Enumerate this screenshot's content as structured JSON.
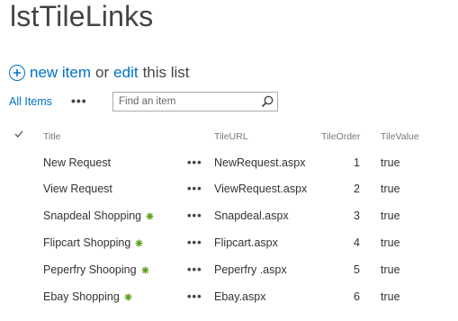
{
  "page": {
    "title": "lstTileLinks"
  },
  "command_bar": {
    "new_item": "new item",
    "or": "or",
    "edit": "edit",
    "this_list": "this list"
  },
  "views": {
    "all_items": "All Items",
    "more": "•••"
  },
  "search": {
    "placeholder": "Find an item"
  },
  "table": {
    "columns": {
      "title": "Title",
      "tileurl": "TileURL",
      "tileorder": "TileOrder",
      "tilevalue": "TileValue"
    },
    "rows": [
      {
        "title": "New Request",
        "is_new": false,
        "ellipsis": "•••",
        "tileurl": "NewRequest.aspx",
        "tileorder": "1",
        "tilevalue": "true"
      },
      {
        "title": "View Request",
        "is_new": false,
        "ellipsis": "•••",
        "tileurl": "ViewRequest.aspx",
        "tileorder": "2",
        "tilevalue": "true"
      },
      {
        "title": "Snapdeal Shopping",
        "is_new": true,
        "ellipsis": "•••",
        "tileurl": "Snapdeal.aspx",
        "tileorder": "3",
        "tilevalue": "true"
      },
      {
        "title": "Flipcart Shopping",
        "is_new": true,
        "ellipsis": "•••",
        "tileurl": "Flipcart.aspx",
        "tileorder": "4",
        "tilevalue": "true"
      },
      {
        "title": "Peperfry Shooping",
        "is_new": true,
        "ellipsis": "•••",
        "tileurl": "Peperfry .aspx",
        "tileorder": "5",
        "tilevalue": "true"
      },
      {
        "title": "Ebay Shopping",
        "is_new": true,
        "ellipsis": "•••",
        "tileurl": "Ebay.aspx",
        "tileorder": "6",
        "tilevalue": "true"
      }
    ]
  },
  "colors": {
    "link": "#0072c6",
    "new_indicator": "#5e9f1d",
    "header_text": "#777777"
  },
  "icons": {
    "add": "plus-circle-icon",
    "search": "magnifier-icon",
    "select_all": "checkmark-icon",
    "new_item": "new-sparkle-icon"
  }
}
